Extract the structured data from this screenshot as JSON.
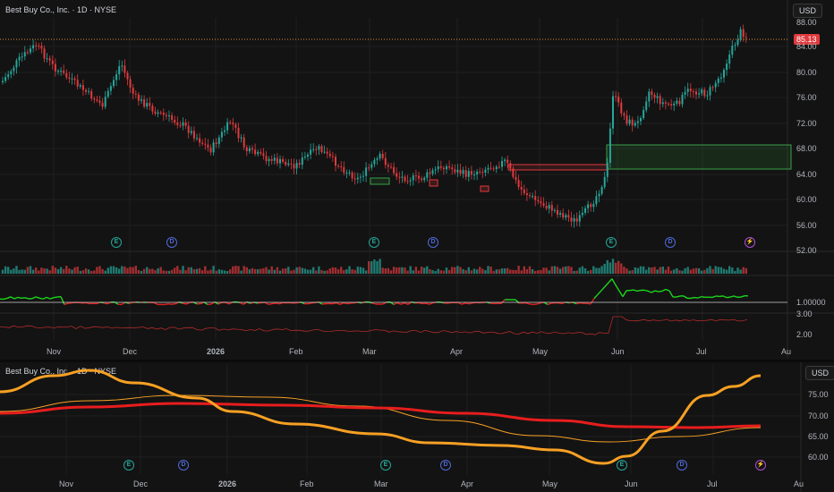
{
  "panel1": {
    "symbol_title": "Best Buy Co., Inc. · 1D · NYSE",
    "currency": "USD",
    "last_price": "85.13",
    "price_axis": [
      "88.00",
      "84.00",
      "80.00",
      "76.00",
      "72.00",
      "68.00",
      "64.00",
      "60.00",
      "56.00",
      "52.00"
    ],
    "indicator1_label": "1.00000",
    "indicator2_labels": [
      "3.00",
      "2.00"
    ],
    "time_axis": [
      "Nov",
      "Dec",
      "2026",
      "Feb",
      "Mar",
      "Apr",
      "May",
      "Jun",
      "Jul",
      "Au"
    ],
    "events": [
      "E",
      "D",
      "E",
      "D",
      "E",
      "D",
      "⚡"
    ]
  },
  "panel2": {
    "symbol_title": "Best Buy Co., Inc. · 1D · NYSE",
    "currency": "USD",
    "price_axis": [
      "75.00",
      "70.00",
      "65.00",
      "60.00"
    ],
    "time_axis": [
      "Nov",
      "Dec",
      "2026",
      "Feb",
      "Mar",
      "Apr",
      "May",
      "Jun",
      "Jul",
      "Au"
    ],
    "events": [
      "E",
      "D",
      "E",
      "D",
      "E",
      "D",
      "⚡"
    ]
  },
  "colors": {
    "up": "#26a69a",
    "down": "#e03a3e",
    "background": "#131313",
    "osc_up": "#1bd61b",
    "osc_down": "#e02020",
    "ma_orange": "#f7a024",
    "ma_red": "#e81d1d",
    "zone_green": "#2e7d32"
  }
}
